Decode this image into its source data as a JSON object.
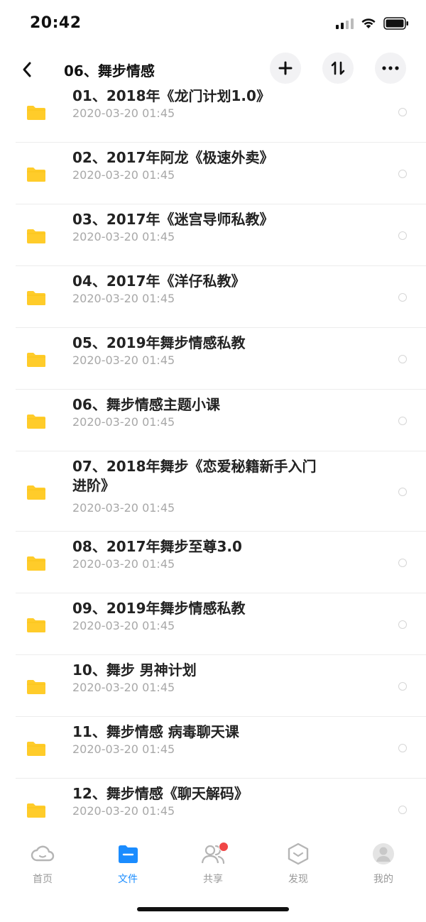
{
  "status_bar": {
    "time": "20:42"
  },
  "header": {
    "title": "06、舞步情感",
    "icons": [
      "chevron-left-icon",
      "plus-icon",
      "sort-icon",
      "more-icon"
    ]
  },
  "files": [
    {
      "title": "01、2018年《龙门计划1.0》",
      "date": "2020-03-20 01:45"
    },
    {
      "title": "02、2017年阿龙《极速外卖》",
      "date": "2020-03-20 01:45"
    },
    {
      "title": "03、2017年《迷宫导师私教》",
      "date": "2020-03-20 01:45"
    },
    {
      "title": "04、2017年《洋仔私教》",
      "date": "2020-03-20 01:45"
    },
    {
      "title": "05、2019年舞步情感私教",
      "date": "2020-03-20 01:45"
    },
    {
      "title": "06、舞步情感主题小课",
      "date": "2020-03-20 01:45"
    },
    {
      "title": "07、2018年舞步《恋爱秘籍新手入门进阶》",
      "date": "2020-03-20 01:45"
    },
    {
      "title": "08、2017年舞步至尊3.0",
      "date": "2020-03-20 01:45"
    },
    {
      "title": "09、2019年舞步情感私教",
      "date": "2020-03-20 01:45"
    },
    {
      "title": "10、舞步 男神计划",
      "date": "2020-03-20 01:45"
    },
    {
      "title": "11、舞步情感 病毒聊天课",
      "date": "2020-03-20 01:45"
    },
    {
      "title": "12、舞步情感《聊天解码》",
      "date": "2020-03-20 01:45"
    }
  ],
  "tabs": [
    {
      "label": "首页",
      "icon": "cloud-icon",
      "active": false
    },
    {
      "label": "文件",
      "icon": "folder-icon",
      "active": true
    },
    {
      "label": "共享",
      "icon": "users-icon",
      "active": false,
      "badge": true
    },
    {
      "label": "发现",
      "icon": "discover-icon",
      "active": false
    },
    {
      "label": "我的",
      "icon": "avatar-icon",
      "active": false
    }
  ],
  "colors": {
    "accent": "#1a8cff",
    "folder": "#ffcc2a",
    "badge": "#f04646",
    "secondary_text": "#a8a8a8"
  }
}
